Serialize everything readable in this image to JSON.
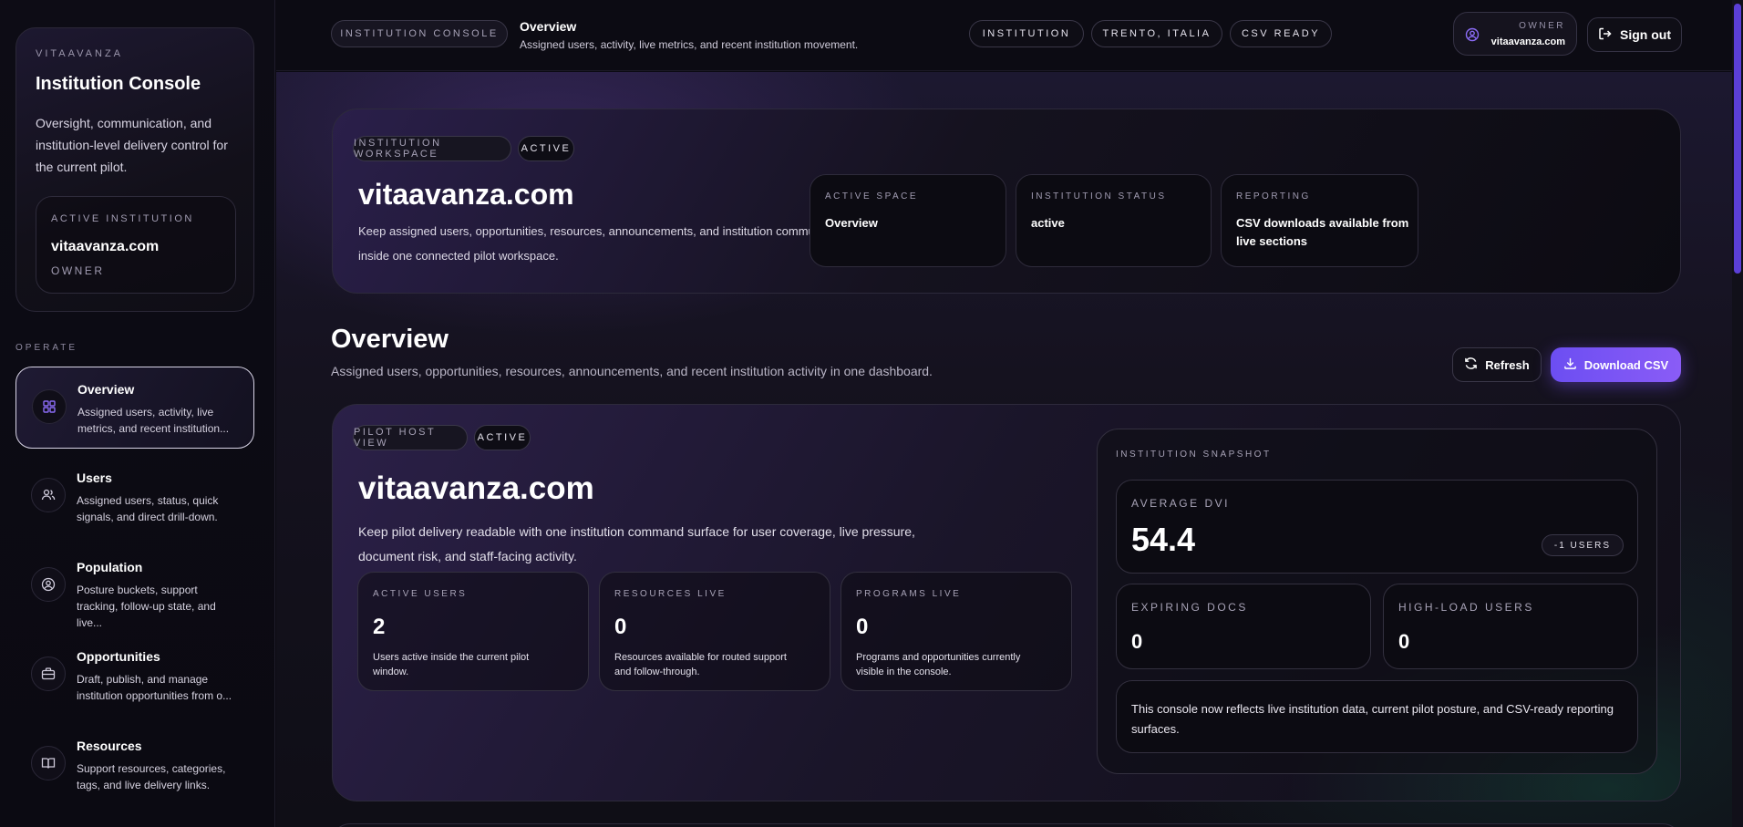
{
  "sidebar": {
    "brand_kicker": "VITAAVANZA",
    "brand_title": "Institution Console",
    "brand_desc": "Oversight, communication, and institution-level delivery control for the current pilot.",
    "active_institution_label": "ACTIVE INSTITUTION",
    "active_institution_name": "vitaavanza.com",
    "active_institution_role": "OWNER",
    "section_label": "OPERATE",
    "items": [
      {
        "title": "Overview",
        "desc": "Assigned users, activity, live metrics, and recent institution...",
        "icon": "grid-icon"
      },
      {
        "title": "Users",
        "desc": "Assigned users, status, quick signals, and direct drill-down.",
        "icon": "users-icon"
      },
      {
        "title": "Population",
        "desc": "Posture buckets, support tracking, follow-up state, and live...",
        "icon": "user-circle-icon"
      },
      {
        "title": "Opportunities",
        "desc": "Draft, publish, and manage institution opportunities from o...",
        "icon": "briefcase-icon"
      },
      {
        "title": "Resources",
        "desc": "Support resources, categories, tags, and live delivery links.",
        "icon": "book-icon"
      }
    ]
  },
  "topbar": {
    "console_pill": "INSTITUTION CONSOLE",
    "title": "Overview",
    "subtitle": "Assigned users, activity, live metrics, and recent institution movement.",
    "tags": [
      "INSTITUTION",
      "TRENTO, ITALIA",
      "CSV READY"
    ],
    "owner_label": "OWNER",
    "owner_name": "vitaavanza.com",
    "signout_label": "Sign out"
  },
  "hero": {
    "workspace_pill": "INSTITUTION WORKSPACE",
    "status_pill": "ACTIVE",
    "title": "vitaavanza.com",
    "desc": "Keep assigned users, opportunities, resources, announcements, and institution communication inside one connected pilot workspace.",
    "stats": [
      {
        "label": "ACTIVE SPACE",
        "value": "Overview"
      },
      {
        "label": "INSTITUTION STATUS",
        "value": "active"
      },
      {
        "label": "REPORTING",
        "value": "CSV downloads available from live sections"
      }
    ]
  },
  "overview": {
    "title": "Overview",
    "subtitle": "Assigned users, opportunities, resources, announcements, and recent institution activity in one dashboard.",
    "refresh_label": "Refresh",
    "download_label": "Download CSV"
  },
  "host": {
    "view_pill": "PILOT HOST VIEW",
    "status_pill": "ACTIVE",
    "title": "vitaavanza.com",
    "desc": "Keep pilot delivery readable with one institution command surface for user coverage, live pressure, document risk, and staff-facing activity.",
    "metrics": [
      {
        "label": "ACTIVE USERS",
        "value": "2",
        "desc": "Users active inside the current pilot window."
      },
      {
        "label": "RESOURCES LIVE",
        "value": "0",
        "desc": "Resources available for routed support and follow-through."
      },
      {
        "label": "PROGRAMS LIVE",
        "value": "0",
        "desc": "Programs and opportunities currently visible in the console."
      }
    ],
    "snapshot": {
      "label": "INSTITUTION SNAPSHOT",
      "avg_dvi_label": "AVERAGE DVI",
      "avg_dvi_value": "54.4",
      "users_pill": "-1 USERS",
      "expiring_label": "EXPIRING DOCS",
      "expiring_value": "0",
      "highload_label": "HIGH-LOAD USERS",
      "highload_value": "0",
      "note": "This console now reflects live institution data, current pilot posture, and CSV-ready reporting surfaces."
    }
  },
  "colors": {
    "accent": "#7b55f4",
    "nav_icon": "#8b6cf6",
    "background": "#0b0a12"
  }
}
